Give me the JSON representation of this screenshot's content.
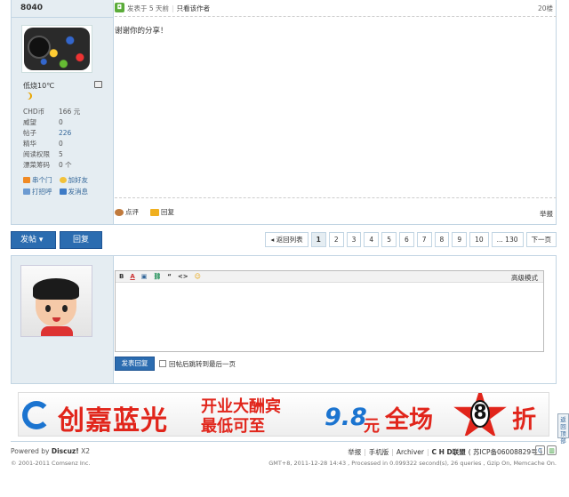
{
  "post": {
    "username": "8040",
    "weather": "低烧10℃",
    "stats": [
      {
        "label": "CHD币",
        "value": "166 元",
        "link": false
      },
      {
        "label": "威望",
        "value": "0",
        "link": false
      },
      {
        "label": "帖子",
        "value": "226",
        "link": true
      },
      {
        "label": "精华",
        "value": "0",
        "link": false
      },
      {
        "label": "阅读权限",
        "value": "5",
        "link": false
      },
      {
        "label": "漂菜筹码",
        "value": "0 个",
        "link": false
      }
    ],
    "actions": {
      "visit": "串个门",
      "add_friend": "加好友",
      "greet": "打招呼",
      "message": "发消息"
    },
    "posted_at": "发表于 5 天前",
    "view_author": "只看该作者",
    "floor": "20楼",
    "content": "谢谢你的分享！",
    "footer": {
      "rate": "点评",
      "reply": "回复",
      "report": "举报"
    }
  },
  "bar": {
    "post_button": "发帖 ▾",
    "reply_button": "回复",
    "pagination": {
      "back": "◂ 返回列表",
      "pages": [
        "1",
        "2",
        "3",
        "4",
        "5",
        "6",
        "7",
        "8",
        "9",
        "10",
        "... 130"
      ],
      "current": "1",
      "next": "下一页"
    }
  },
  "reply": {
    "toolbar": [
      "B",
      "A",
      "▣",
      "⛓",
      "“",
      "<>",
      "☺"
    ],
    "advanced_mode": "高级模式",
    "submit": "发表回复",
    "jump_label": "回帖后跳转到最后一页"
  },
  "banner": {
    "brand": "创嘉蓝光",
    "line1": "开业大酬宾",
    "line2": "最低可至",
    "price": "9.8",
    "unit": "元",
    "all": "全场",
    "discount": "8",
    "off": "折"
  },
  "back_to_top": "返回顶部",
  "footer": {
    "powered_by": "Powered by",
    "product": "Discuz!",
    "version": "X2",
    "copyright": "© 2001-2011 Comsenz Inc.",
    "links": [
      "举报",
      "手机版",
      "Archiver"
    ],
    "alliance": "C H D联盟",
    "icp": "( 苏ICP备06008829号 )",
    "debug": "GMT+8, 2011-12-28 14:43 , Processed in 0.099322 second(s), 26 queries , Gzip On, Memcache On."
  },
  "colors": {
    "accent": "#2b6cb0",
    "sidebar": "#e5edf2",
    "border": "#c2d5e3",
    "banner_red": "#e1251b",
    "banner_blue": "#1b74d0"
  }
}
